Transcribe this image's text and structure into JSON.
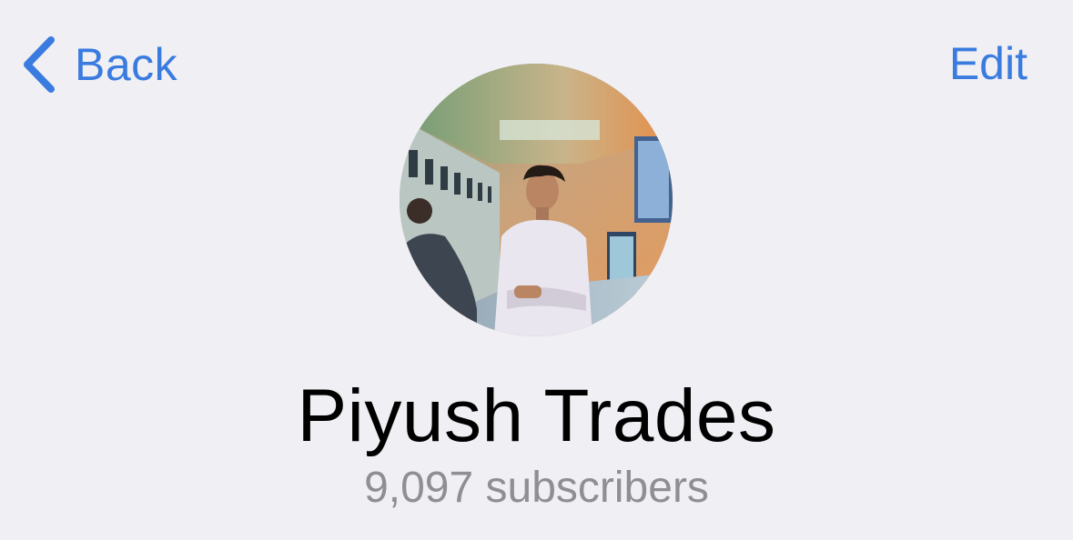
{
  "nav": {
    "back_label": "Back",
    "edit_label": "Edit"
  },
  "profile": {
    "name": "Piyush Trades",
    "subscribers": "9,097 subscribers"
  },
  "colors": {
    "accent": "#3a7be0",
    "background": "#efeff4",
    "secondary_text": "#8e8e93"
  },
  "icons": {
    "back": "chevron-left-icon"
  }
}
